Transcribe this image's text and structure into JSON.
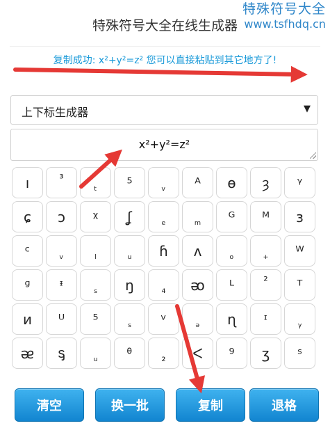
{
  "watermark": {
    "site_name": "特殊符号大全",
    "url": "www.tsfhdq.cn"
  },
  "header": {
    "title": "特殊符号大全在线生成器"
  },
  "status": {
    "message": "复制成功: x²+y²=z² 您可以直接粘贴到其它地方了!"
  },
  "generator_select": {
    "selected": "上下标生成器"
  },
  "output": {
    "value": "x²+y²=z²"
  },
  "symbols": [
    "ı",
    "³",
    "ₜ",
    "⁵",
    "ᵥ",
    "ᴬ",
    "ɵ",
    "ȝ",
    "ᵞ",
    "ɕ",
    "ↄ",
    "ᵡ",
    "ʆ",
    "ₑ",
    "ₘ",
    "ᴳ",
    "ᴹ",
    "ɜ",
    "ᶜ",
    "ᵥ",
    "ₗ",
    "ᵤ",
    "ɦ",
    "ᴧ",
    "ₒ",
    "₊",
    "ᵂ",
    "ᶢ",
    "ᶧ",
    "ₛ",
    "ŋ",
    "₄",
    "ᴔ",
    "ᴸ",
    "²",
    "ᵀ",
    "ᴎ",
    "ᵁ",
    "⁵",
    "ₛ",
    "ᵛ",
    "ₔ",
    "ɳ",
    "ᶦ",
    "ᵧ",
    "ᴂ",
    "ᶊ",
    "ᵤ",
    "ᶿ",
    "₂",
    "ᐸ",
    "⁹",
    "ʒ",
    "ˢ"
  ],
  "buttons": {
    "clear": "清空",
    "refresh": "换一批",
    "copy": "复制",
    "back": "退格"
  },
  "colors": {
    "accent": "#1a9ad9",
    "button": "#1285d0",
    "annotation_arrow": "#e53935"
  }
}
